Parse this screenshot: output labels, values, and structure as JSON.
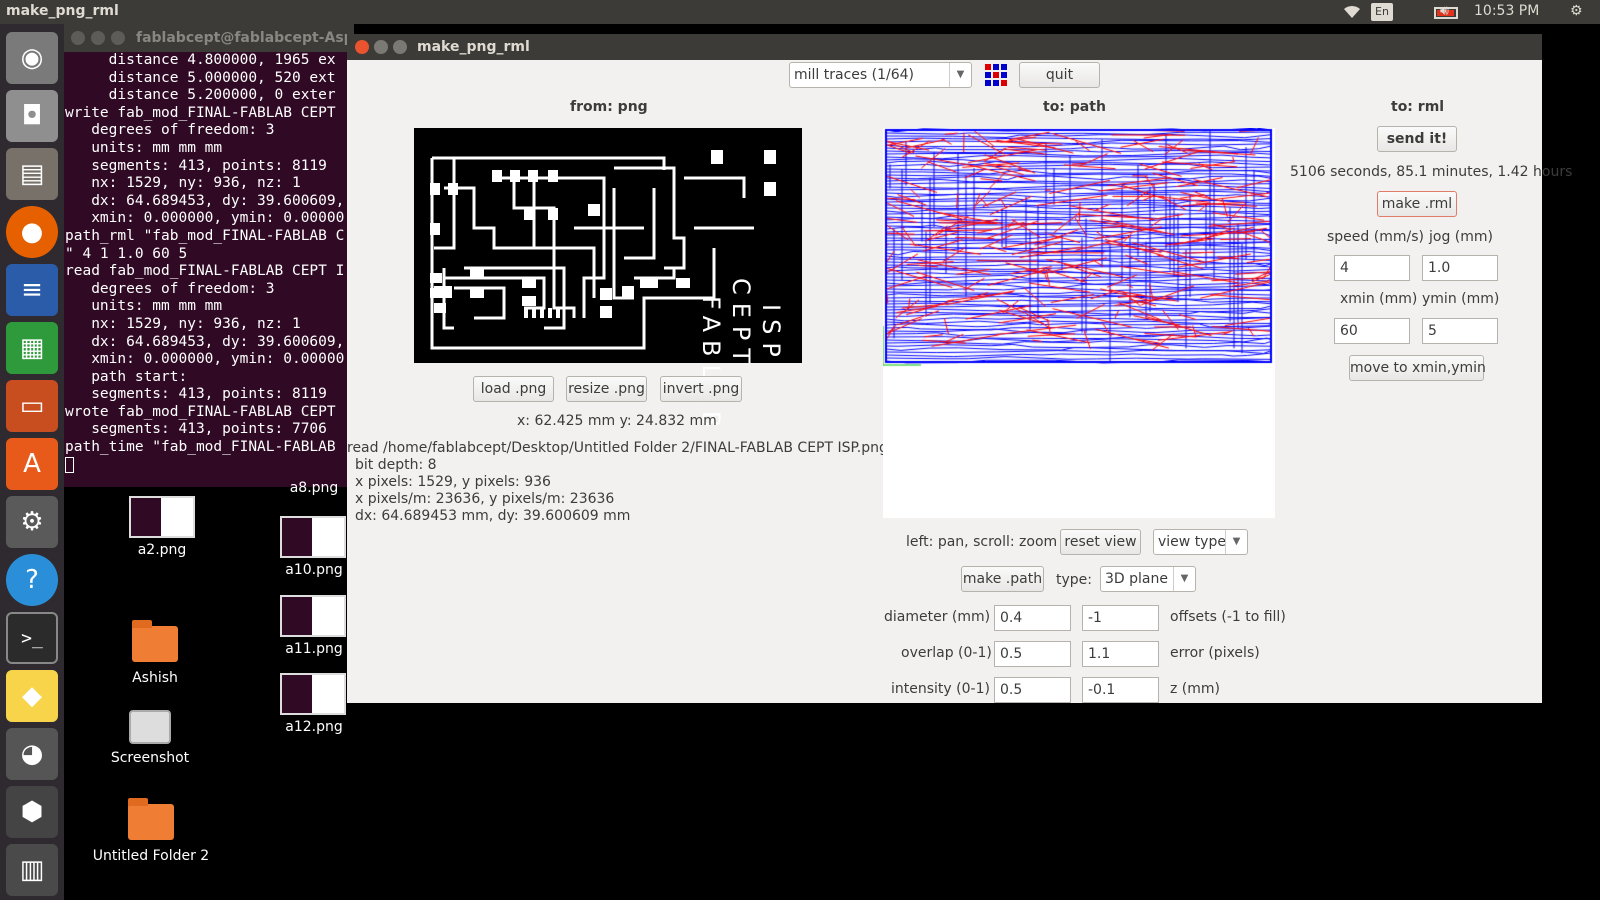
{
  "topbar": {
    "title": "make_png_rml",
    "keyboard": "En",
    "clock": "10:53 PM"
  },
  "terminal": {
    "title": "fablabcept@fablabcept-Aspire",
    "lines": [
      "     distance 4.800000, 1965 ex",
      "     distance 5.000000, 520 ext",
      "     distance 5.200000, 0 exter",
      "write fab_mod_FINAL-FABLAB CEPT",
      "   degrees of freedom: 3",
      "   units: mm mm mm",
      "   segments: 413, points: 8119",
      "   nx: 1529, ny: 936, nz: 1",
      "   dx: 64.689453, dy: 39.600609,",
      "   xmin: 0.000000, ymin: 0.00000",
      "path_rml \"fab_mod_FINAL-FABLAB C",
      "\" 4 1 1.0 60 5",
      "read fab_mod_FINAL-FABLAB CEPT I",
      "   degrees of freedom: 3",
      "   units: mm mm mm",
      "   nx: 1529, ny: 936, nz: 1",
      "   dx: 64.689453, dy: 39.600609,",
      "   xmin: 0.000000, ymin: 0.00000",
      "   path start:",
      "   segments: 413, points: 8119",
      "wrote fab_mod_FINAL-FABLAB CEPT",
      "   segments: 413, points: 7706",
      "path_time \"fab_mod_FINAL-FABLAB"
    ]
  },
  "desktop": {
    "a2": "a2.png",
    "a8": "a8.png",
    "a10": "a10.png",
    "a11": "a11.png",
    "a12": "a12.png",
    "ashish": "Ashish",
    "screenshot": "Screenshot",
    "untitled": "Untitled Folder 2"
  },
  "app": {
    "title": "make_png_rml",
    "process_select": "mill traces (1/64)",
    "quit": "quit",
    "from_header": "from: png",
    "to_path_header": "to: path",
    "to_rml_header": "to: rml",
    "pcb_text": [
      "FABLAB",
      "CEPT",
      "ISP"
    ],
    "load_png": "load .png",
    "resize_png": "resize .png",
    "invert_png": "invert .png",
    "coords": "x: 62.425 mm  y: 24.832 mm",
    "info": [
      "read /home/fablabcept/Desktop/Untitled Folder 2/FINAL-FABLAB CEPT ISP.png",
      "bit depth: 8",
      "x pixels: 1529, y pixels: 936",
      "x pixels/m: 23636, y pixels/m: 23636",
      "dx: 64.689453 mm, dy: 39.600609 mm"
    ],
    "pan_hint": "left: pan, scroll: zoom",
    "reset_view": "reset view",
    "view_type": "view type",
    "make_path": "make .path",
    "type_label": "type:",
    "type_value": "3D plane",
    "diameter_label": "diameter (mm)",
    "diameter": "0.4",
    "offsets": "-1",
    "offsets_label": "offsets (-1 to fill)",
    "overlap_label": "overlap (0-1)",
    "overlap": "0.5",
    "error": "1.1",
    "error_label": "error (pixels)",
    "intensity_label": "intensity (0-1)",
    "intensity": "0.5",
    "z": "-0.1",
    "z_label": "z (mm)",
    "send": "send it!",
    "time": "5106 seconds, 85.1 minutes, 1.42 hours",
    "make_rml": "make .rml",
    "speed_label": "speed (mm/s)",
    "speed": "4",
    "jog_label": "jog (mm)",
    "jog": "1.0",
    "xmin_label": "xmin (mm)",
    "xmin": "60",
    "ymin_label": "ymin (mm)",
    "ymin": "5",
    "move": "move to xmin,ymin"
  },
  "colors": {
    "path_blue": "#0000ff",
    "path_red": "#ff0000",
    "terminal_bg": "#300a24"
  }
}
